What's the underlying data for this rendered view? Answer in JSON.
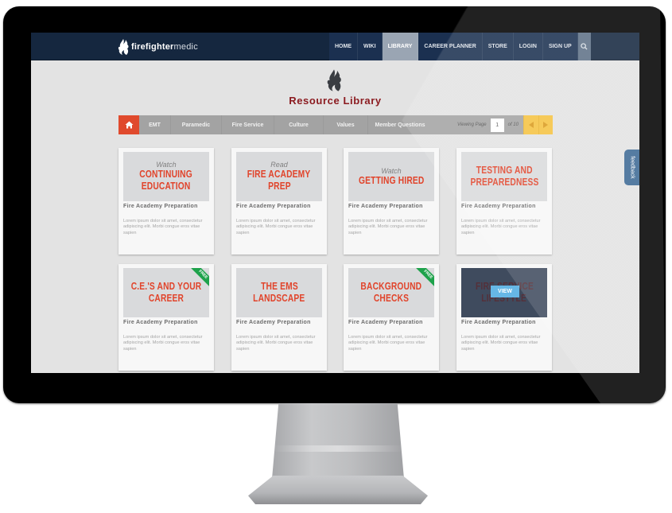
{
  "site": {
    "logo_bold": "firefighter",
    "logo_light": "medic"
  },
  "nav": {
    "items": [
      {
        "label": "HOME",
        "active": false
      },
      {
        "label": "WIKI",
        "active": false
      },
      {
        "label": "LIBRARY",
        "active": true
      },
      {
        "label": "CAREER PLANNER",
        "active": false
      },
      {
        "label": "STORE",
        "active": false
      },
      {
        "label": "LOGIN",
        "active": false
      },
      {
        "label": "SIGN UP",
        "active": false
      }
    ],
    "search_icon": "search-icon"
  },
  "page": {
    "title": "Resource Library"
  },
  "filterbar": {
    "home_icon": "home-icon",
    "categories": [
      "EMT",
      "Paramedic",
      "Fire Service",
      "Culture",
      "Values",
      "Member Questions"
    ],
    "pager": {
      "label": "Viewing Page",
      "current_page": "1",
      "of_label": "of 10"
    },
    "prev_icon": "triangle-left-icon",
    "next_icon": "triangle-right-icon"
  },
  "cards": [
    {
      "kicker": "Watch",
      "headline": [
        "CONTINUING",
        "EDUCATION"
      ],
      "subtitle": "Fire Academy Preparation",
      "body": "Lorem ipsum dolor sit amet, consectetur adipiscing elit. Morbi congue eros vitae sapien",
      "badge": null,
      "dark": false,
      "overlay": null
    },
    {
      "kicker": "Read",
      "headline": [
        "FIRE ACADEMY",
        "PREP"
      ],
      "subtitle": "Fire Academy Preparation",
      "body": "Lorem ipsum dolor sit amet, consectetur adipiscing elit. Morbi congue eros vitae sapien",
      "badge": null,
      "dark": false,
      "overlay": null
    },
    {
      "kicker": "Watch",
      "headline": [
        "GETTING HIRED"
      ],
      "subtitle": "Fire Academy Preparation",
      "body": "Lorem ipsum dolor sit amet, consectetur adipiscing elit. Morbi congue eros vitae sapien",
      "badge": null,
      "dark": false,
      "overlay": null
    },
    {
      "kicker": "",
      "headline": [
        "TESTING AND",
        "PREPAREDNESS"
      ],
      "subtitle": "Fire Academy Preparation",
      "body": "Lorem ipsum dolor sit amet, consectetur adipiscing elit. Morbi congue eros vitae sapien",
      "badge": null,
      "dark": false,
      "overlay": null
    },
    {
      "kicker": "",
      "headline": [
        "C.E.'S AND YOUR",
        "CAREER"
      ],
      "subtitle": "Fire Academy Preparation",
      "body": "Lorem ipsum dolor sit amet, consectetur adipiscing elit. Morbi congue eros vitae sapien",
      "badge": "FREE",
      "dark": false,
      "overlay": null
    },
    {
      "kicker": "",
      "headline": [
        "THE EMS",
        "LANDSCAPE"
      ],
      "subtitle": "Fire Academy Preparation",
      "body": "Lorem ipsum dolor sit amet, consectetur adipiscing elit. Morbi congue eros vitae sapien",
      "badge": null,
      "dark": false,
      "overlay": null
    },
    {
      "kicker": "",
      "headline": [
        "BACKGROUND",
        "CHECKS"
      ],
      "subtitle": "Fire Academy Preparation",
      "body": "Lorem ipsum dolor sit amet, consectetur adipiscing elit. Morbi congue eros vitae sapien",
      "badge": "FREE",
      "dark": false,
      "overlay": null
    },
    {
      "kicker": "",
      "headline": [
        "FIRE SERVICE",
        "LIFESTYLE"
      ],
      "subtitle": "Fire Academy Preparation",
      "body": "Lorem ipsum dolor sit amet, consectetur adipiscing elit. Morbi congue eros vitae sapien",
      "badge": null,
      "dark": true,
      "overlay": "VIEW"
    }
  ],
  "feedback": {
    "label": "feedback"
  },
  "colors": {
    "header_bg": "#15273f",
    "title_red": "#8b1a1f",
    "headline_red": "#e1442b",
    "home_orange": "#e04a2d",
    "pager_yellow": "#f5c242",
    "free_green": "#1ea24b",
    "view_blue": "#66b7e6",
    "feedback_blue": "#3c6894"
  }
}
